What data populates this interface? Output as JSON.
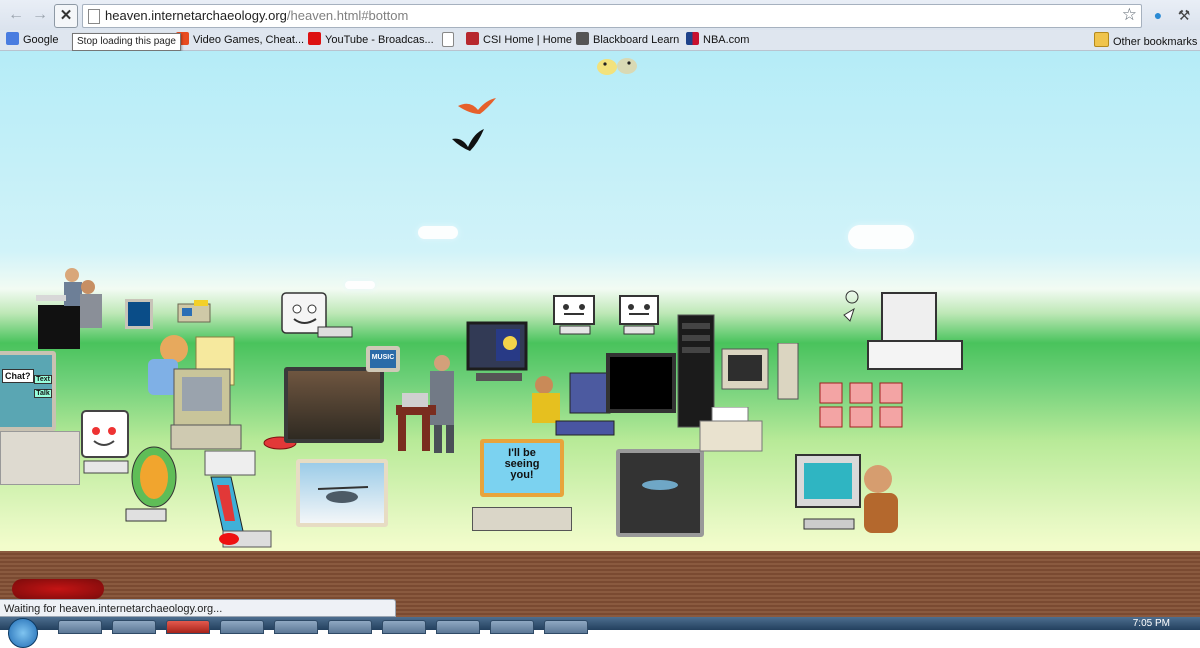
{
  "browser": {
    "url_host": "heaven.internetarchaeology.org",
    "url_path": "/heaven.html#bottom",
    "stop_tooltip": "Stop loading this page",
    "status_text": "Waiting for heaven.internetarchaeology.org..."
  },
  "bookmarks": [
    {
      "label": "Google",
      "icon": "google-icon"
    },
    {
      "label": "Video Games, Cheat...",
      "icon": "gamespot-icon"
    },
    {
      "label": "YouTube - Broadcas...",
      "icon": "youtube-icon"
    },
    {
      "label": "",
      "icon": "page-icon"
    },
    {
      "label": "CSI Home | Home",
      "icon": "csi-icon"
    },
    {
      "label": "Blackboard Learn",
      "icon": "blackboard-icon"
    },
    {
      "label": "NBA.com",
      "icon": "nba-icon"
    }
  ],
  "other_bookmarks": "Other bookmarks",
  "scene": {
    "monitor_text": "I'll be seeing you!",
    "music_label": "MUSIC",
    "chat_label": "Chat?",
    "button_text": "Text",
    "button_talk": "Talk"
  },
  "taskbar": {
    "clock": "7:05 PM"
  },
  "colors": {
    "sky": "#b5ecf7",
    "grass": "#49c35c",
    "ground": "#8a5a3f",
    "chrome": "#dfe6ef"
  }
}
